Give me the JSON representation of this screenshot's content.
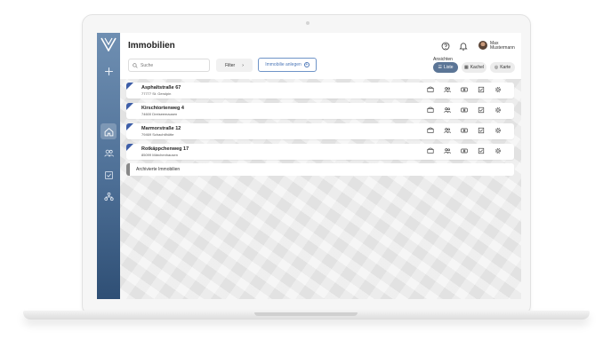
{
  "app": {
    "page_title": "Immobilien",
    "search_placeholder": "Suche",
    "filter_label": "Filter",
    "filter_chevron": "›",
    "add_button_label": "Immobilie anlegen",
    "add_button_icon": "+"
  },
  "user": {
    "first_name": "Max",
    "last_name": "Mustermann"
  },
  "views": {
    "label": "Ansichten",
    "options": [
      {
        "label": "Liste",
        "active": true,
        "icon": "list-icon"
      },
      {
        "label": "Kachel",
        "active": false,
        "icon": "grid-icon"
      },
      {
        "label": "Karte",
        "active": false,
        "icon": "map-icon"
      }
    ]
  },
  "properties": [
    {
      "street": "Asphaltstraße 67",
      "city": "77777 St. Gerolpin"
    },
    {
      "street": "Kirschtortenweg 4",
      "city": "74600 Dreiseemausen"
    },
    {
      "street": "Marmorstraße 12",
      "city": "79469 Schachtlhütte"
    },
    {
      "street": "Rotkäppchenweg 17",
      "city": "85099 Märchenhausen"
    }
  ],
  "archive_label": "Archivierte Immobilien",
  "colors": {
    "sidebar_top": "#6f8fb2",
    "sidebar_bottom": "#2f4f75",
    "accent": "#4d78b8",
    "row_corner": "#3d5ea8",
    "active_view": "#5b7596"
  },
  "row_action_icons": [
    "building-icon",
    "people-icon",
    "money-icon",
    "checklist-icon",
    "gear-icon"
  ]
}
